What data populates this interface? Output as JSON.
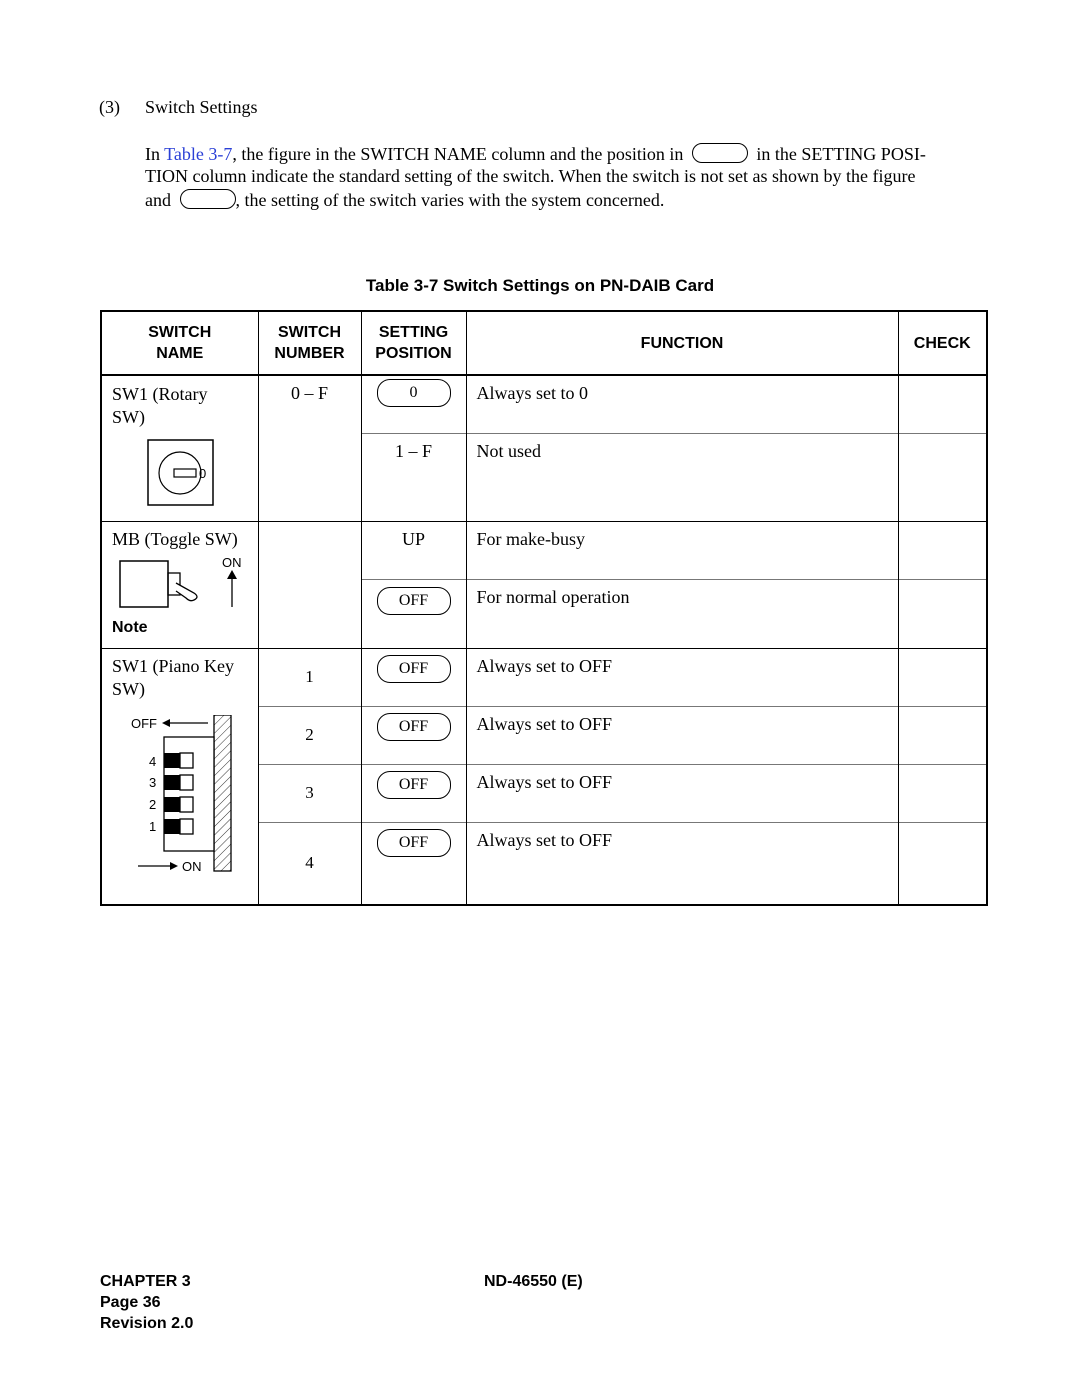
{
  "section": {
    "number": "(3)",
    "title": "Switch Settings"
  },
  "paragraph": {
    "line1_prefix": "In ",
    "line1_link": "Table 3-7",
    "line1_mid": ", the figure in the SWITCH NAME column and the position in",
    "line1_suffix": "in the SETTING POSI-",
    "line2": "TION column indicate the standard setting of the switch. When the switch is not set as shown by the figure",
    "line3_prefix": "and",
    "line3_suffix": ", the setting of the switch varies with the system concerned."
  },
  "table": {
    "caption": "Table 3-7  Switch Settings on PN-DAIB Card",
    "headers": {
      "switch_name": [
        "SWITCH",
        "NAME"
      ],
      "switch_number": [
        "SWITCH",
        "NUMBER"
      ],
      "setting_position": [
        "SETTING",
        "POSITION"
      ],
      "function": "FUNCTION",
      "check": "CHECK"
    },
    "groups": [
      {
        "name_lines": [
          "SW1 (Rotary",
          "SW)"
        ],
        "figure": "rotary-switch",
        "figure_label": "0",
        "number": "0 – F",
        "rows": [
          {
            "position": "0",
            "standard": true,
            "function": "Always set to 0",
            "check": ""
          },
          {
            "position": "1 – F",
            "standard": false,
            "function": "Not used",
            "check": ""
          }
        ]
      },
      {
        "name_lines": [
          "MB (Toggle SW)"
        ],
        "figure": "toggle-switch",
        "figure_label": "ON",
        "note": "Note",
        "number": "",
        "rows": [
          {
            "position": "UP",
            "standard": false,
            "function": "For make-busy",
            "check": ""
          },
          {
            "position": "OFF",
            "standard": true,
            "function": "For normal operation",
            "check": ""
          }
        ]
      },
      {
        "name_lines": [
          "SW1 (Piano Key",
          "SW)"
        ],
        "figure": "piano-key-switch",
        "figure_off_label": "OFF",
        "figure_on_label": "ON",
        "figure_key_labels": [
          "4",
          "3",
          "2",
          "1"
        ],
        "rows": [
          {
            "number": "1",
            "position": "OFF",
            "standard": true,
            "function": "Always set to OFF",
            "check": ""
          },
          {
            "number": "2",
            "position": "OFF",
            "standard": true,
            "function": "Always set to OFF",
            "check": ""
          },
          {
            "number": "3",
            "position": "OFF",
            "standard": true,
            "function": "Always set to OFF",
            "check": ""
          },
          {
            "number": "4",
            "position": "OFF",
            "standard": true,
            "function": "Always set to OFF",
            "check": ""
          }
        ]
      }
    ]
  },
  "footer": {
    "chapter": "CHAPTER 3",
    "page": "Page 36",
    "revision": "Revision 2.0",
    "doc_id": "ND-46550 (E)"
  },
  "colors": {
    "link": "#2a3fd6",
    "text": "#000000"
  }
}
